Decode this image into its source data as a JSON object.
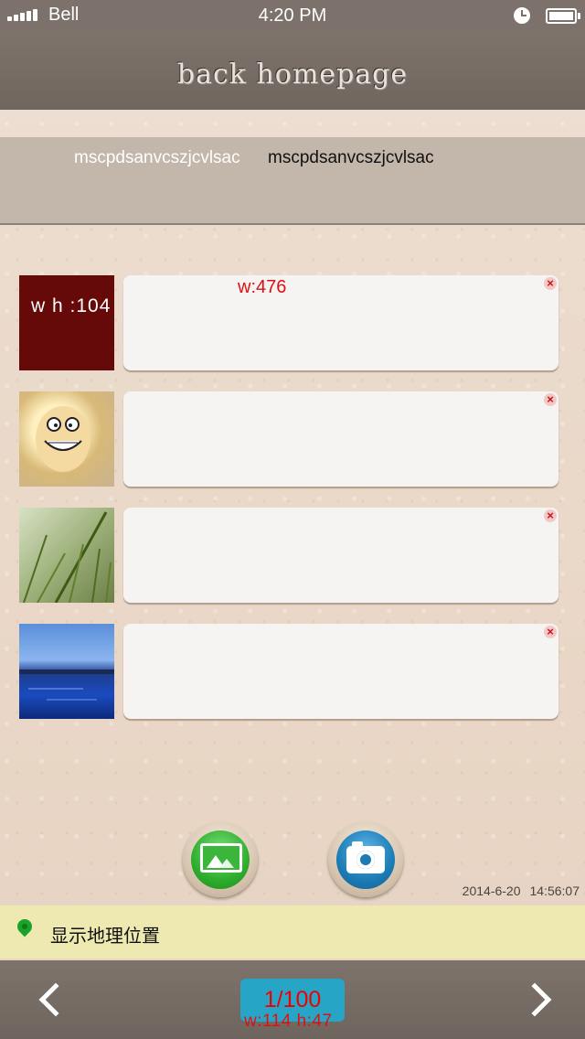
{
  "status_bar": {
    "carrier": "Bell",
    "time": "4:20 PM",
    "icons": [
      "signal-icon",
      "alarm-icon",
      "battery-icon"
    ]
  },
  "nav": {
    "title": "back homepage"
  },
  "channels": [
    {
      "label": "mscpdsanvcszjcvlsac",
      "active": false
    },
    {
      "label": "mscpdsanvcszjcvlsac",
      "active": true
    }
  ],
  "items": [
    {
      "thumb_label": "w h :104",
      "width_label": "w:476",
      "delete_icon": "×"
    },
    {
      "thumb_label": "",
      "width_label": "",
      "delete_icon": "×"
    },
    {
      "thumb_label": "",
      "width_label": "",
      "delete_icon": "×"
    },
    {
      "thumb_label": "",
      "width_label": "",
      "delete_icon": "×"
    }
  ],
  "actions": {
    "gallery_icon": "gallery-icon",
    "camera_icon": "camera-icon"
  },
  "timestamp": {
    "date": "2014-6-20",
    "time": "14:56:07"
  },
  "location": {
    "label": "显示地理位置"
  },
  "pager": {
    "page": "1/100",
    "size_label": "w:114  h:47"
  },
  "colors": {
    "bar": "#7c726b",
    "location_bg": "#eee9b0",
    "accent": "#27a5c6",
    "annotation": "#e01010"
  }
}
